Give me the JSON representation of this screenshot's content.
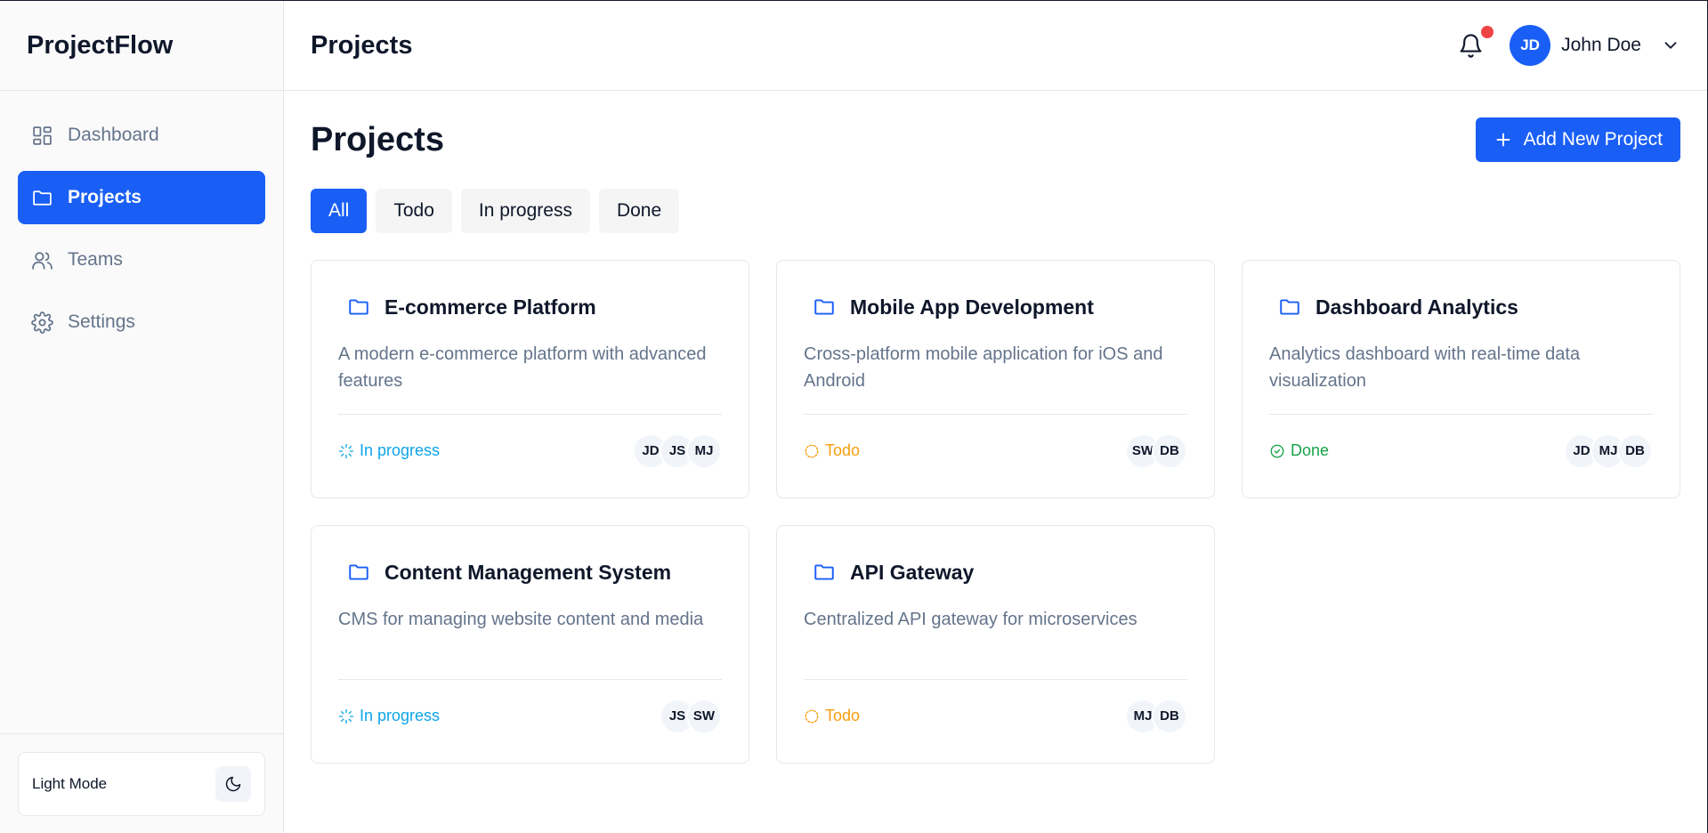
{
  "app": {
    "brand": "ProjectFlow"
  },
  "sidebar": {
    "items": [
      {
        "label": "Dashboard",
        "icon": "dashboard-icon"
      },
      {
        "label": "Projects",
        "icon": "folder-icon"
      },
      {
        "label": "Teams",
        "icon": "users-icon"
      },
      {
        "label": "Settings",
        "icon": "gear-icon"
      }
    ],
    "active_index": 1,
    "theme_label": "Light Mode"
  },
  "header": {
    "title": "Projects",
    "user_initials": "JD",
    "user_name": "John Doe",
    "has_notification": true
  },
  "main": {
    "title": "Projects",
    "add_button": "Add New Project",
    "filters": [
      "All",
      "Todo",
      "In progress",
      "Done"
    ],
    "active_filter": "All"
  },
  "projects": [
    {
      "title": "E-commerce Platform",
      "desc": "A modern e-commerce platform with advanced features",
      "status": "In progress",
      "members": [
        "JD",
        "JS",
        "MJ"
      ]
    },
    {
      "title": "Mobile App Development",
      "desc": "Cross-platform mobile application for iOS and Android",
      "status": "Todo",
      "members": [
        "SW",
        "DB"
      ]
    },
    {
      "title": "Dashboard Analytics",
      "desc": "Analytics dashboard with real-time data visualization",
      "status": "Done",
      "members": [
        "JD",
        "MJ",
        "DB"
      ]
    },
    {
      "title": "Content Management System",
      "desc": "CMS for managing website content and media",
      "status": "In progress",
      "members": [
        "JS",
        "SW"
      ]
    },
    {
      "title": "API Gateway",
      "desc": "Centralized API gateway for microservices",
      "status": "Todo",
      "members": [
        "MJ",
        "DB"
      ]
    }
  ],
  "colors": {
    "accent": "#1a5ff5",
    "status_in_progress": "#0ea5e9",
    "status_todo": "#f59e0b",
    "status_done": "#16a34a",
    "notification": "#ef4444"
  }
}
